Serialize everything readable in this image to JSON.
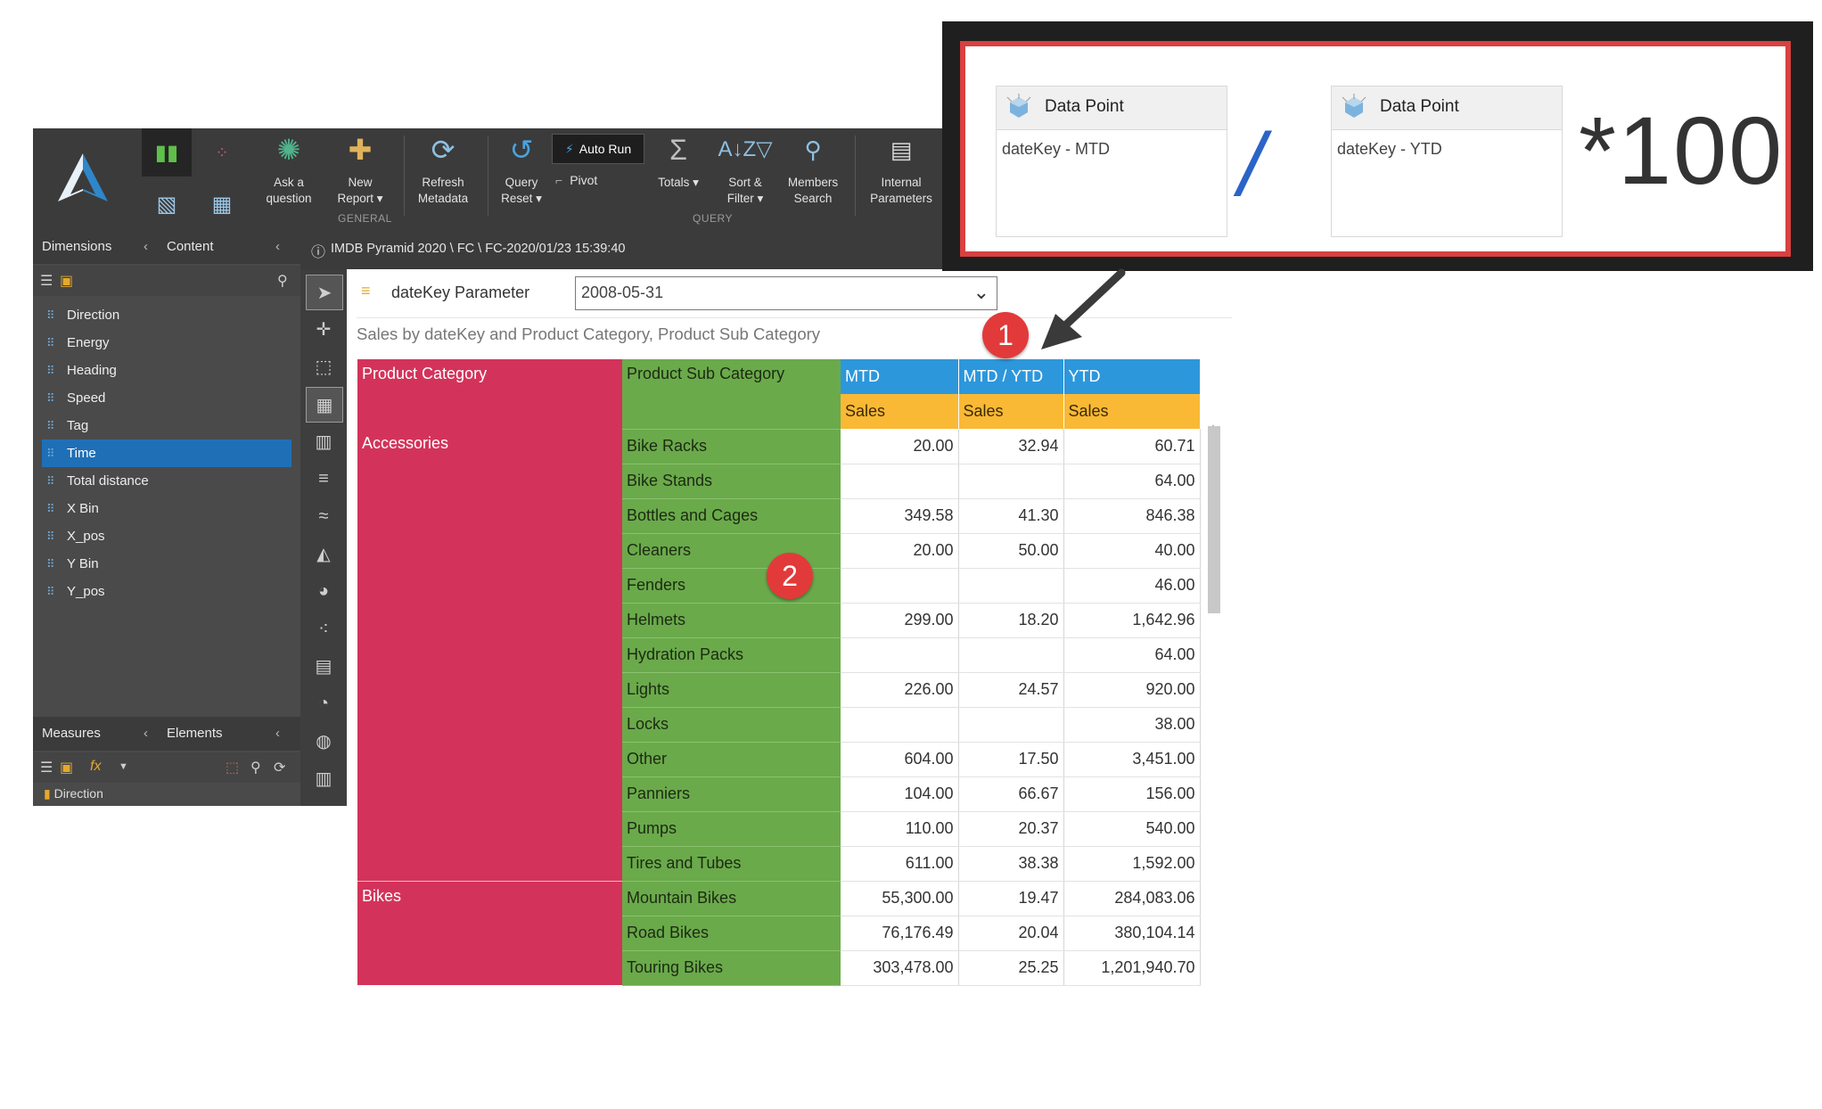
{
  "ribbon": {
    "buttons": [
      {
        "label": "Ask a\nquestion",
        "icon": "brain-icon"
      },
      {
        "label": "New\nReport ▾",
        "icon": "new-report-icon"
      },
      {
        "label": "Refresh\nMetadata",
        "icon": "refresh-metadata-icon"
      },
      {
        "label": "Query\nReset ▾",
        "icon": "query-reset-icon"
      },
      {
        "label": "Totals ▾",
        "icon": "sigma-icon"
      },
      {
        "label": "Sort &\nFilter ▾",
        "icon": "sort-filter-icon"
      },
      {
        "label": "Members\nSearch",
        "icon": "members-search-icon"
      },
      {
        "label": "Internal\nParameters",
        "icon": "internal-parameters-icon"
      }
    ],
    "auto_run": "Auto Run",
    "pivot": "Pivot",
    "group_general": "GENERAL",
    "group_query": "QUERY"
  },
  "panels": {
    "dimensions": "Dimensions",
    "content": "Content",
    "measures": "Measures",
    "elements": "Elements",
    "dimension_items": [
      "Direction",
      "Energy",
      "Heading",
      "Speed",
      "Tag",
      "Time",
      "Total distance",
      "X Bin",
      "X_pos",
      "Y Bin",
      "Y_pos"
    ],
    "selected_item": "Time",
    "partial_item": "Direction"
  },
  "breadcrumb": "IMDB Pyramid 2020 \\ FC \\ FC-2020/01/23 15:39:40",
  "parameter": {
    "label": "dateKey Parameter",
    "value": "2008-05-31"
  },
  "report_subtitle": "Sales by dateKey and Product Category, Product Sub Category",
  "grid": {
    "headers": {
      "category": "Product Category",
      "subcategory": "Product Sub Category",
      "mtd": "MTD",
      "ratio": "MTD / YTD",
      "ytd": "YTD",
      "measure": "Sales"
    },
    "groups": [
      {
        "category": "Accessories",
        "rows": [
          {
            "sub": "Bike Racks",
            "mtd": "20.00",
            "ratio": "32.94",
            "ytd": "60.71"
          },
          {
            "sub": "Bike Stands",
            "mtd": "",
            "ratio": "",
            "ytd": "64.00"
          },
          {
            "sub": "Bottles and Cages",
            "mtd": "349.58",
            "ratio": "41.30",
            "ytd": "846.38"
          },
          {
            "sub": "Cleaners",
            "mtd": "20.00",
            "ratio": "50.00",
            "ytd": "40.00"
          },
          {
            "sub": "Fenders",
            "mtd": "",
            "ratio": "",
            "ytd": "46.00"
          },
          {
            "sub": "Helmets",
            "mtd": "299.00",
            "ratio": "18.20",
            "ytd": "1,642.96"
          },
          {
            "sub": "Hydration Packs",
            "mtd": "",
            "ratio": "",
            "ytd": "64.00"
          },
          {
            "sub": "Lights",
            "mtd": "226.00",
            "ratio": "24.57",
            "ytd": "920.00"
          },
          {
            "sub": "Locks",
            "mtd": "",
            "ratio": "",
            "ytd": "38.00"
          },
          {
            "sub": "Other",
            "mtd": "604.00",
            "ratio": "17.50",
            "ytd": "3,451.00"
          },
          {
            "sub": "Panniers",
            "mtd": "104.00",
            "ratio": "66.67",
            "ytd": "156.00"
          },
          {
            "sub": "Pumps",
            "mtd": "110.00",
            "ratio": "20.37",
            "ytd": "540.00"
          },
          {
            "sub": "Tires and Tubes",
            "mtd": "611.00",
            "ratio": "38.38",
            "ytd": "1,592.00"
          }
        ]
      },
      {
        "category": "Bikes",
        "rows": [
          {
            "sub": "Mountain Bikes",
            "mtd": "55,300.00",
            "ratio": "19.47",
            "ytd": "284,083.06"
          },
          {
            "sub": "Road Bikes",
            "mtd": "76,176.49",
            "ratio": "20.04",
            "ytd": "380,104.14"
          },
          {
            "sub": "Touring Bikes",
            "mtd": "303,478.00",
            "ratio": "25.25",
            "ytd": "1,201,940.70"
          }
        ]
      }
    ]
  },
  "callout": {
    "left": {
      "title": "Data Point",
      "body": "dateKey - MTD"
    },
    "operator": "/",
    "right": {
      "title": "Data Point",
      "body": "dateKey - YTD"
    },
    "multiplier": "*100"
  },
  "badges": [
    "1",
    "2"
  ],
  "colors": {
    "category": "#d3335a",
    "subcategory": "#6aaa4b",
    "column_header": "#2d97db",
    "measure_header": "#f9b935",
    "callout_border": "#d94040",
    "selection": "#1f6fb6"
  }
}
